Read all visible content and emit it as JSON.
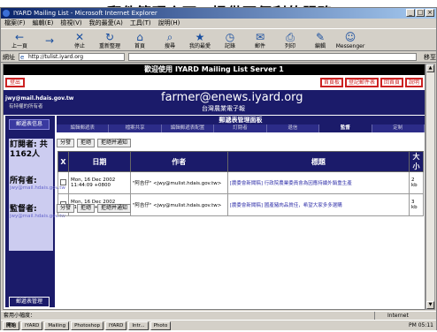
{
  "banner": {
    "text": "IYARD郵件管理介面：提供更便利的服務"
  },
  "window": {
    "title": "IYARD Mailing List - Microsoft Internet Explorer"
  },
  "menubar": [
    "檔案(F)",
    "編輯(E)",
    "檢視(V)",
    "我的最愛(A)",
    "工具(T)",
    "說明(H)"
  ],
  "toolbar": [
    {
      "label": "上一頁",
      "icon": "back-arrow-icon",
      "glyph": "←"
    },
    {
      "label": "",
      "icon": "forward-arrow-icon",
      "glyph": "→"
    },
    {
      "label": "停止",
      "icon": "stop-icon",
      "glyph": "✕"
    },
    {
      "label": "重新整理",
      "icon": "refresh-icon",
      "glyph": "↻"
    },
    {
      "label": "首頁",
      "icon": "home-icon",
      "glyph": "⌂"
    },
    {
      "label": "搜尋",
      "icon": "search-icon",
      "glyph": "⌕"
    },
    {
      "label": "我的最愛",
      "icon": "favorites-icon",
      "glyph": "★"
    },
    {
      "label": "記錄",
      "icon": "history-icon",
      "glyph": "◷"
    },
    {
      "label": "郵件",
      "icon": "mail-icon",
      "glyph": "✉"
    },
    {
      "label": "列印",
      "icon": "print-icon",
      "glyph": "⎙"
    },
    {
      "label": "編輯",
      "icon": "edit-icon",
      "glyph": "✎"
    },
    {
      "label": "Messenger",
      "icon": "messenger-icon",
      "glyph": "☺"
    }
  ],
  "addressbar": {
    "label": "網址",
    "url": "http://tulist.iyard.org",
    "go": "移至"
  },
  "page": {
    "welcome": "歡迎使用 IYARD Mailing List Server 1",
    "logout": "登出",
    "toplinks": [
      "首頁板",
      "登記郵件表",
      "回首頁",
      "說明"
    ],
    "user": "jwy@mail.hdais.gov.tw",
    "user_role": "有特權的所有者",
    "list_address": "farmer@enews.iyard.org",
    "list_description": "台灣農業電子報",
    "panel_title": "郵遞表管理面板",
    "tabs": [
      "編輯郵遞表",
      "檔案共享",
      "編輯郵遞表配置",
      "訂閱者",
      "退信",
      "監督",
      "定制"
    ],
    "active_tab": "監督",
    "sidebar_button": "郵遞表信息",
    "subscribers": "訂閱者: 共1162人",
    "owner_label": "所有者:",
    "owner_email": "jwy@mail.hdais.gov.tw",
    "moderator_label": "監督者:",
    "moderator_email": "jwy@mail.hdais.gov.tw",
    "sidebar_admin": "郵遞表管理",
    "actions": [
      "分發",
      "拒絕",
      "拒絕并通知"
    ],
    "table": {
      "headers": [
        "X",
        "日期",
        "作者",
        "標題",
        "大小"
      ],
      "rows": [
        {
          "date": "Mon, 16 Dec 2002 11:44:09 +0800",
          "author": "\"阿吉仔\" <jwy@mulist.hdais.gov.tw>",
          "subject": "[農委會新聞稿] 行政院農業委員會為因應持續外銷重生產",
          "size": "2 kb"
        },
        {
          "date": "Mon, 16 Dec 2002 11:40:01 +0800",
          "author": "\"阿吉仔\" <jwy@mulist.hdais.gov.tw>",
          "subject": "[農委會新聞稿] 國產豬肉品質佳，希望大家多多選購",
          "size": "3 kb"
        }
      ]
    }
  },
  "statusbar": {
    "left": "套用小幅度：",
    "zone": "Internet"
  },
  "taskbar": [
    "開始",
    "IYARD",
    "Mailing",
    "Photoshop",
    "IYARD",
    "Intr...",
    "Photo"
  ],
  "clock": "PM 05:11"
}
